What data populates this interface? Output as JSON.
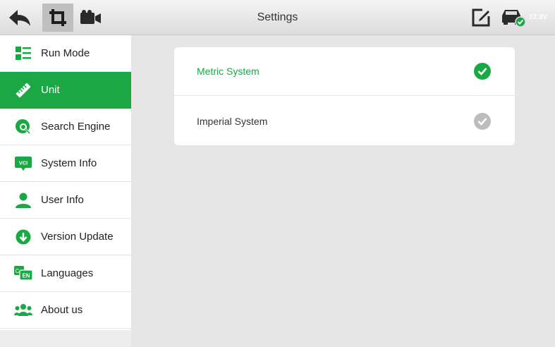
{
  "window": {
    "title": "Settings",
    "battery_voltage": "12.3V"
  },
  "toolbar": {
    "back_icon": "back-arrow-icon",
    "screenshot_icon": "crop-screenshot-icon",
    "record_icon": "video-camera-icon",
    "edit_icon": "edit-note-icon",
    "vehicle_icon": "car-connected-icon"
  },
  "sidebar": {
    "items": [
      {
        "label": "Run Mode",
        "icon": "list-grid-icon",
        "active": false
      },
      {
        "label": "Unit",
        "icon": "ruler-icon",
        "active": true
      },
      {
        "label": "Search Engine",
        "icon": "search-globe-icon",
        "active": false
      },
      {
        "label": "System Info",
        "icon": "vci-icon",
        "icon_text": "VCI",
        "active": false
      },
      {
        "label": "User Info",
        "icon": "user-icon",
        "active": false
      },
      {
        "label": "Version Update",
        "icon": "download-icon",
        "active": false
      },
      {
        "label": "Languages",
        "icon": "language-icon",
        "icon_text": "EN",
        "active": false
      },
      {
        "label": "About us",
        "icon": "group-icon",
        "active": false
      }
    ]
  },
  "main": {
    "options": [
      {
        "label": "Metric System",
        "selected": true
      },
      {
        "label": "Imperial System",
        "selected": false
      }
    ]
  },
  "colors": {
    "accent": "#1aa845",
    "check_inactive": "#bdbdbd",
    "icon_green": "#1aa845"
  }
}
